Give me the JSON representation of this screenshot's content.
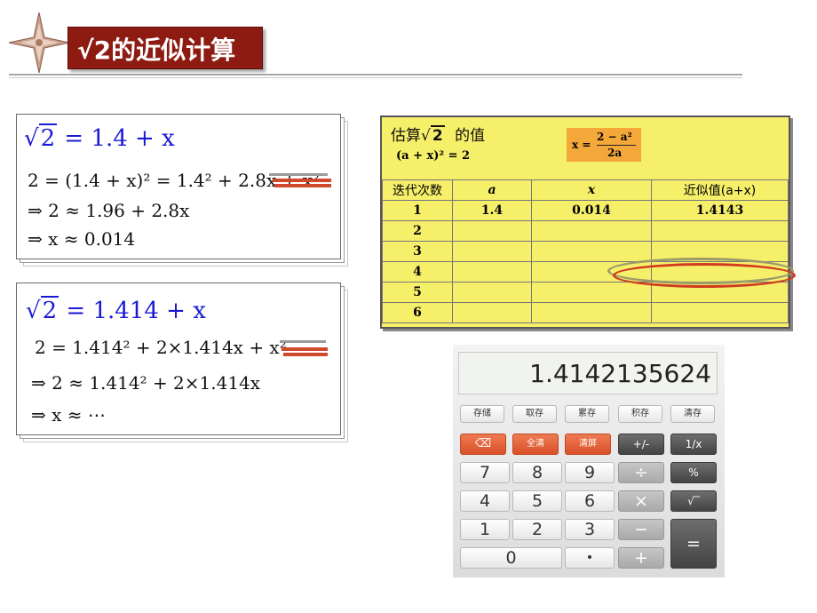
{
  "title": {
    "text": "√2的近似计算"
  },
  "box1": {
    "line1_lhs": "2",
    "line1_rhs": "= 1.4 + x",
    "line2": "2 = (1.4 + x)² = 1.4² + 2.8x + x²",
    "line3": "⇒ 2 ≈ 1.96 + 2.8x",
    "line4": "⇒ x ≈ 0.014"
  },
  "box2": {
    "line1_lhs": "2",
    "line1_rhs": "= 1.414 + x",
    "line2": "2 = 1.414² + 2×1.414x + x²",
    "line3": "⇒ 2 ≈ 1.414² + 2×1.414x",
    "line4": "⇒ x ≈ ⋯"
  },
  "sheet": {
    "heading_pre": "估算",
    "heading_root": "2",
    "heading_post": "的值",
    "subheading": "(a + x)² = 2",
    "formula_lhs": "x =",
    "formula_num": "2 − a²",
    "formula_den": "2a",
    "columns": [
      "迭代次数",
      "a",
      "x",
      "近似值(a+x)"
    ],
    "rows": [
      [
        "1",
        "1.4",
        "0.014",
        "1.4143"
      ],
      [
        "2",
        "",
        "",
        ""
      ],
      [
        "3",
        "",
        "",
        ""
      ],
      [
        "4",
        "",
        "",
        ""
      ],
      [
        "5",
        "",
        "",
        ""
      ],
      [
        "6",
        "",
        "",
        ""
      ]
    ]
  },
  "calculator": {
    "display": "1.4142135624",
    "memory_keys": [
      "存储",
      "取存",
      "累存",
      "积存",
      "清存"
    ],
    "backspace": "⌫",
    "clear_all": "全清",
    "clear_entry": "清屏",
    "plus_minus": "+/-",
    "reciprocal": "1/x",
    "digits": [
      "7",
      "8",
      "9",
      "4",
      "5",
      "6",
      "1",
      "2",
      "3",
      "0"
    ],
    "divide": "÷",
    "percent": "%",
    "multiply": "×",
    "sqrt": "√‾",
    "minus": "−",
    "equals": "=",
    "dot": "•",
    "plus": "+"
  }
}
